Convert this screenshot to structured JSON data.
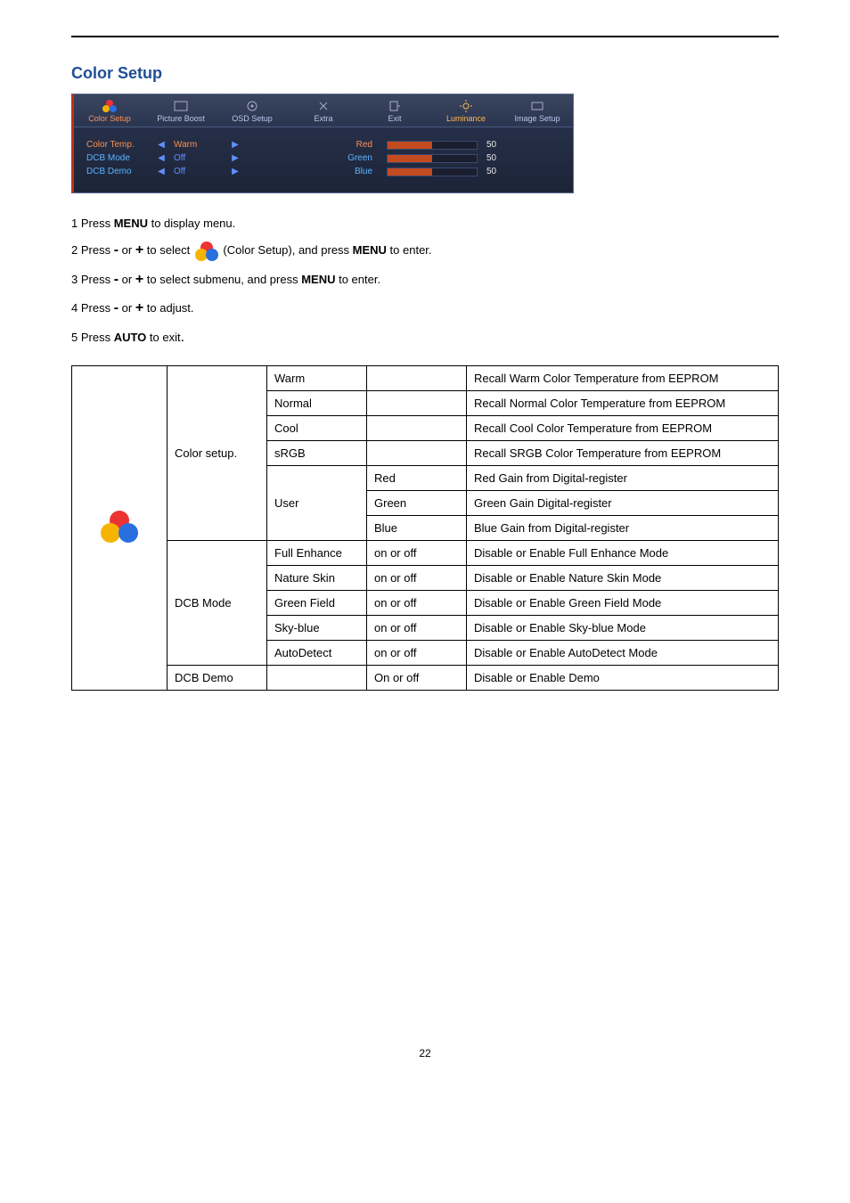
{
  "section_title": "Color Setup",
  "page_number": "22",
  "osd": {
    "tabs": [
      "Color Setup",
      "Picture Boost",
      "OSD Setup",
      "Extra",
      "Exit",
      "Luminance",
      "Image Setup"
    ],
    "rows": [
      {
        "label": "Color Temp.",
        "value": "Warm",
        "highlight": true
      },
      {
        "label": "DCB Mode",
        "value": "Off",
        "highlight": false
      },
      {
        "label": "DCB Demo",
        "value": "Off",
        "highlight": false
      }
    ],
    "sliders": [
      {
        "label": "Red",
        "value": "50"
      },
      {
        "label": "Green",
        "value": "50"
      },
      {
        "label": "Blue",
        "value": "50"
      }
    ]
  },
  "instructions": {
    "l1a": "1 Press ",
    "l1b": "MENU",
    "l1c": " to display menu.",
    "l2a": "2 Press ",
    "l2b": " or ",
    "l2c": " to select  ",
    "l2d": "  (Color Setup), and press ",
    "l2e": "MENU",
    "l2f": " to enter.",
    "l3a": "3 Press ",
    "l3b": " or ",
    "l3c": " to select submenu, and press ",
    "l3d": "MENU",
    "l3e": " to enter.",
    "l4a": "4 Press ",
    "l4b": " or ",
    "l4c": " to adjust.",
    "l5a": "5 Press ",
    "l5b": "AUTO",
    "l5c": " to exit",
    "minus": "-",
    "plus": "+",
    "dot": "."
  },
  "table": {
    "groups": [
      {
        "category": "Color setup.",
        "rows": [
          {
            "sub": "Warm",
            "opt": "",
            "desc": "Recall Warm Color Temperature from EEPROM"
          },
          {
            "sub": "Normal",
            "opt": "",
            "desc": "Recall Normal Color Temperature from EEPROM"
          },
          {
            "sub": "Cool",
            "opt": "",
            "desc": "Recall Cool Color Temperature from EEPROM"
          },
          {
            "sub": "sRGB",
            "opt": "",
            "desc": "Recall SRGB Color Temperature from EEPROM"
          }
        ],
        "user": {
          "sub": "User",
          "rows": [
            {
              "opt": "Red",
              "desc": "Red Gain from Digital-register"
            },
            {
              "opt": "Green",
              "desc": "Green Gain Digital-register"
            },
            {
              "opt": "Blue",
              "desc": "Blue Gain from Digital-register"
            }
          ]
        }
      },
      {
        "category": "DCB Mode",
        "rows": [
          {
            "sub": "Full Enhance",
            "opt": "on or off",
            "desc": "Disable or Enable Full Enhance Mode"
          },
          {
            "sub": "Nature Skin",
            "opt": "on or off",
            "desc": "Disable or Enable Nature Skin Mode"
          },
          {
            "sub": "Green Field",
            "opt": "on or off",
            "desc": "Disable or Enable Green Field Mode"
          },
          {
            "sub": "Sky-blue",
            "opt": "on or off",
            "desc": "Disable or Enable Sky-blue Mode"
          },
          {
            "sub": "AutoDetect",
            "opt": "on or off",
            "desc": "Disable or Enable AutoDetect Mode"
          }
        ]
      },
      {
        "category": "DCB Demo",
        "rows": [
          {
            "sub": "",
            "opt": "On or off",
            "desc": "Disable or Enable Demo"
          }
        ]
      }
    ]
  }
}
